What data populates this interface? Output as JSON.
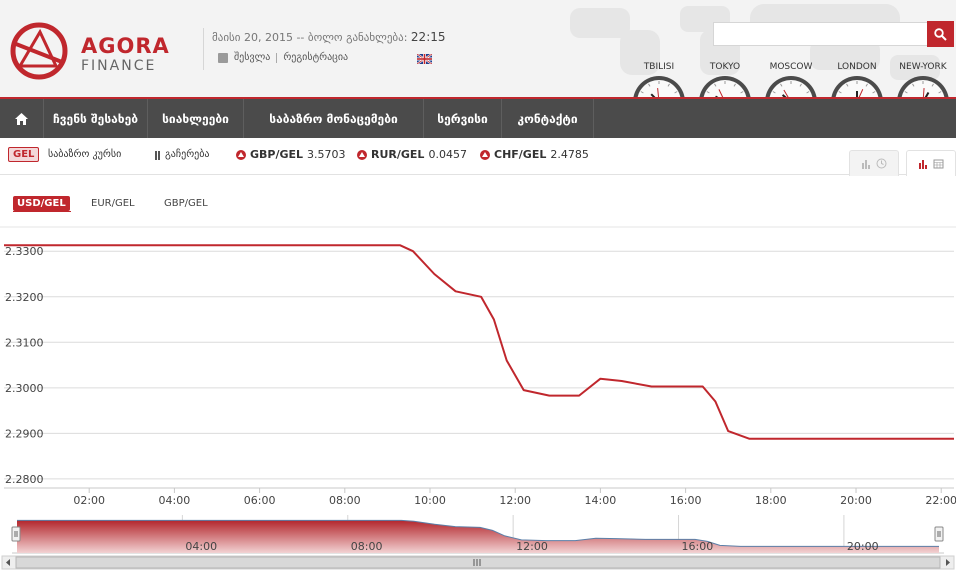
{
  "header": {
    "logo_name": "AGORA",
    "logo_sub": "FINANCE",
    "date_text": "მაისი 20, 2015 -- ბოლო განახლება: ",
    "time_text": "22:15",
    "login_label": "შესვლა",
    "register_label": "რეგისტრაცია",
    "search_placeholder": ""
  },
  "clocks": [
    {
      "city": "TBILISI"
    },
    {
      "city": "TOKYO"
    },
    {
      "city": "MOSCOW"
    },
    {
      "city": "LONDON"
    },
    {
      "city": "NEW-YORK"
    }
  ],
  "nav": {
    "items": [
      {
        "label": "ჩვენს შესახებ"
      },
      {
        "label": "სიახლეები"
      },
      {
        "label": "საბაზრო მონაცემები"
      },
      {
        "label": "სერვისი"
      },
      {
        "label": "კონტაქტი"
      }
    ]
  },
  "ticker": {
    "badge": "GEL",
    "market_rate_label": "საბაზრო კურსი",
    "pause_label": "გაჩერება",
    "rates": [
      {
        "pair": "GBP/GEL",
        "value": "3.5703"
      },
      {
        "pair": "RUR/GEL",
        "value": "0.0457"
      },
      {
        "pair": "CHF/GEL",
        "value": "2.4785"
      }
    ]
  },
  "currency_tabs": [
    {
      "label": "USD/GEL",
      "active": true
    },
    {
      "label": "EUR/GEL",
      "active": false
    },
    {
      "label": "GBP/GEL",
      "active": false
    }
  ],
  "colors": {
    "brand": "#c0272d",
    "nav_bg": "#4b4b4b",
    "series": "#c0272d",
    "navigator_line": "#5b7fa8"
  },
  "chart_data": {
    "type": "line",
    "title": "",
    "xlabel": "",
    "ylabel": "",
    "x_ticks": [
      "02:00",
      "04:00",
      "06:00",
      "08:00",
      "10:00",
      "12:00",
      "14:00",
      "16:00",
      "18:00",
      "20:00",
      "22:00"
    ],
    "y_ticks": [
      "2.3300",
      "2.3200",
      "2.3100",
      "2.3000",
      "2.2900",
      "2.2800"
    ],
    "ylim": [
      2.278,
      2.334
    ],
    "xlim": [
      0.0,
      22.3
    ],
    "grid": true,
    "series": [
      {
        "x": [
          0.0,
          9.3,
          9.6,
          10.1,
          10.6,
          11.2,
          11.5,
          11.8,
          12.2,
          12.8,
          13.5,
          14.0,
          14.5,
          15.2,
          16.4,
          16.7,
          17.0,
          17.5,
          22.3
        ],
        "y": [
          2.3313,
          2.3313,
          2.33,
          2.325,
          2.3212,
          2.32,
          2.315,
          2.306,
          2.2995,
          2.2983,
          2.2983,
          2.302,
          2.3015,
          2.3003,
          2.3003,
          2.297,
          2.2905,
          2.2888,
          2.2888
        ]
      }
    ],
    "navigator": {
      "x_ticks": [
        "04:00",
        "08:00",
        "12:00",
        "16:00",
        "20:00"
      ]
    }
  }
}
